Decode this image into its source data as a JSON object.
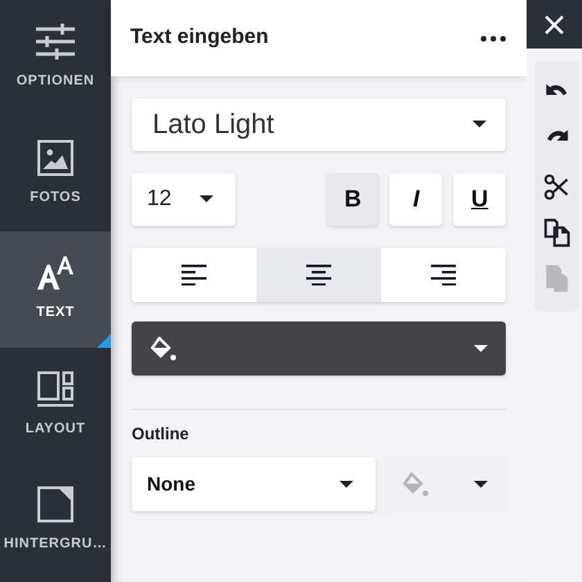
{
  "sidebar": {
    "items": [
      {
        "kind": "sliders",
        "label": "OPTIONEN",
        "selected": false
      },
      {
        "kind": "photo",
        "label": "FOTOS",
        "selected": false
      },
      {
        "kind": "text",
        "label": "TEXT",
        "selected": true
      },
      {
        "kind": "layout",
        "label": "LAYOUT",
        "selected": false
      },
      {
        "kind": "background",
        "label": "HINTERGRU…",
        "selected": false
      }
    ]
  },
  "panel": {
    "title": "Text eingeben",
    "font": {
      "value": "Lato Light"
    },
    "size": {
      "value": "12"
    },
    "styles": [
      {
        "kind": "bold",
        "label": "B",
        "selected": true
      },
      {
        "kind": "italic",
        "label": "I",
        "selected": false
      },
      {
        "kind": "underline",
        "label": "U",
        "selected": false
      }
    ],
    "align": [
      {
        "kind": "left",
        "selected": false
      },
      {
        "kind": "center",
        "selected": true
      },
      {
        "kind": "right",
        "selected": false
      }
    ],
    "fill": {
      "color": "#444446"
    },
    "outline": {
      "label": "Outline",
      "value": "None",
      "fill_disabled": true
    }
  },
  "toolbar": [
    {
      "kind": "undo",
      "disabled": false
    },
    {
      "kind": "redo",
      "disabled": false
    },
    {
      "kind": "cut",
      "disabled": false
    },
    {
      "kind": "copy",
      "disabled": false
    },
    {
      "kind": "paste",
      "disabled": true
    }
  ]
}
